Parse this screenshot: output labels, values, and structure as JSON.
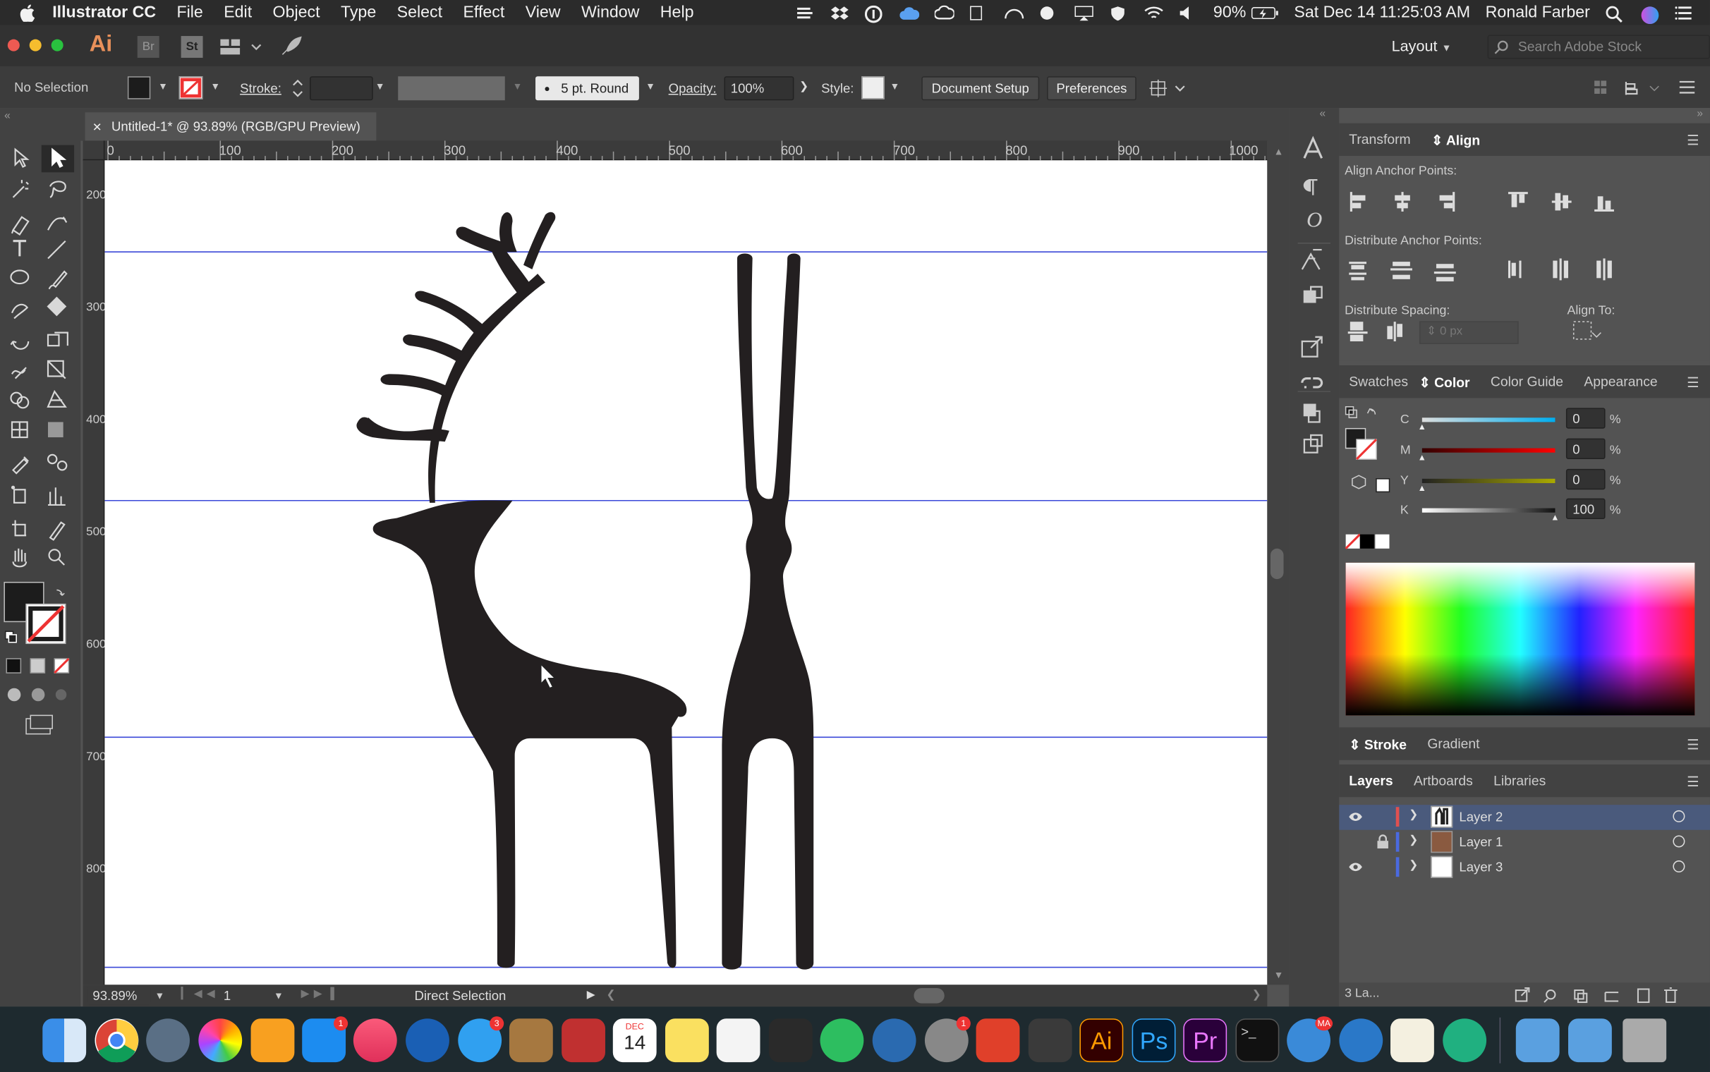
{
  "menubar": {
    "app_name": "Illustrator CC",
    "items": [
      "File",
      "Edit",
      "Object",
      "Type",
      "Select",
      "Effect",
      "View",
      "Window",
      "Help"
    ],
    "battery": "90%",
    "datetime": "Sat Dec 14  11:25:03 AM",
    "user": "Ronald Farber"
  },
  "appbar": {
    "logo": "Ai",
    "bridge": "Br",
    "stock": "St",
    "workspace": "Layout",
    "search_placeholder": "Search Adobe Stock"
  },
  "control": {
    "selection": "No Selection",
    "stroke_label": "Stroke:",
    "brush": "5 pt. Round",
    "opacity_label": "Opacity:",
    "opacity_value": "100%",
    "style_label": "Style:",
    "doc_setup": "Document Setup",
    "preferences": "Preferences"
  },
  "document": {
    "tab_title": "Untitled-1* @ 93.89% (RGB/GPU Preview)",
    "close": "×"
  },
  "ruler": {
    "h": [
      "0",
      "100",
      "200",
      "300",
      "400",
      "500",
      "600",
      "700",
      "800",
      "900",
      "1000"
    ],
    "v": [
      "200",
      "300",
      "400",
      "500",
      "600",
      "700",
      "800"
    ]
  },
  "status": {
    "zoom": "93.89%",
    "artboard": "1",
    "tool": "Direct Selection"
  },
  "align_panel": {
    "tabs": [
      "Transform",
      "Align"
    ],
    "active": "Align",
    "anchor_label": "Align Anchor Points:",
    "distribute_label": "Distribute Anchor Points:",
    "spacing_label": "Distribute Spacing:",
    "align_to_label": "Align To:",
    "spacing_value": "0 px"
  },
  "color_panel": {
    "tabs": [
      "Swatches",
      "Color",
      "Color Guide",
      "Appearance"
    ],
    "active": "Color",
    "channels": [
      {
        "name": "C",
        "value": "0",
        "pct": 0
      },
      {
        "name": "M",
        "value": "0",
        "pct": 0
      },
      {
        "name": "Y",
        "value": "0",
        "pct": 0
      },
      {
        "name": "K",
        "value": "100",
        "pct": 100
      }
    ],
    "unit": "%"
  },
  "stroke_panel": {
    "tabs": [
      "Stroke",
      "Gradient"
    ],
    "active": "Stroke"
  },
  "layers_panel": {
    "tabs": [
      "Layers",
      "Artboards",
      "Libraries"
    ],
    "active": "Layers",
    "layers": [
      {
        "name": "Layer 2",
        "color": "#e05050",
        "visible": true,
        "locked": false,
        "selected": true
      },
      {
        "name": "Layer 1",
        "color": "#4a6ae0",
        "visible": false,
        "locked": true,
        "selected": false
      },
      {
        "name": "Layer 3",
        "color": "#4a6ae0",
        "visible": true,
        "locked": false,
        "selected": false
      }
    ],
    "count": "3 La..."
  },
  "dock": {
    "badges": {
      "appstore": "1",
      "messages": "3",
      "calendar_month": "DEC",
      "calendar_day": "14",
      "sysprefs": "1",
      "meta": "MA"
    },
    "app_labels": {
      "illustrator": "Ai",
      "photoshop": "Ps",
      "premiere": "Pr",
      "terminal": ">_"
    }
  },
  "colors": {
    "artwork": "#231f20",
    "guide": "#3a48d8",
    "accent": "#4a6ae0"
  }
}
